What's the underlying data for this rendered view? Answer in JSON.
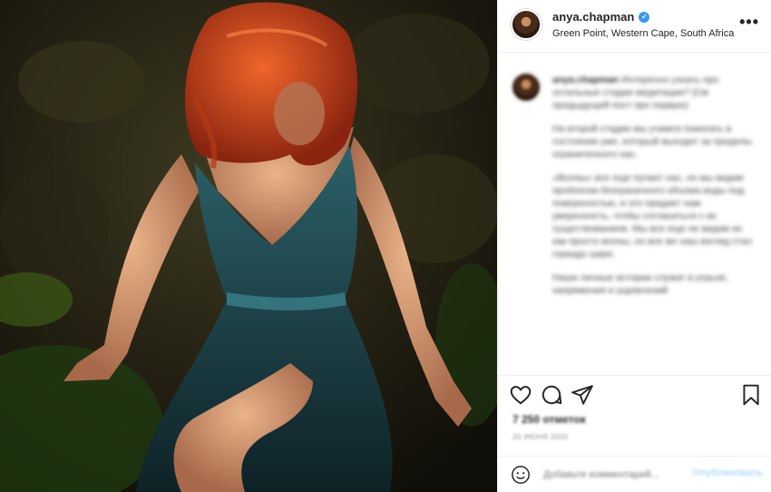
{
  "header": {
    "username": "anya.chapman",
    "location": "Green Point, Western Cape, South Africa",
    "more_label": "•••"
  },
  "caption": {
    "username": "anya.chapman",
    "paragraphs": [
      "Интересно узнать про остальные стадии медитации? (См предыдущий пост про первую)",
      "На второй стадии мы учимся помогать в состоянии уже, который выходит за пределы ограниченного нас.",
      "«Волны» все еще пугают нас, но мы видим проблески безграничного объема воды под поверхностью, и это придает нам уверенность, чтобы согласиться с их существованием. Мы все еще не видим их как просто волны, но все же наш взгляд стал гораздо шире.",
      "Наши личные истории служат в угрызе, напряжения и ущемлений"
    ]
  },
  "stats": {
    "likes": "7 250 отметок",
    "date": "20 ИЮНЯ 2020"
  },
  "comment": {
    "placeholder": "Добавьте комментарий...",
    "post_label": "Опубликовать"
  },
  "colors": {
    "verified": "#3897f0",
    "dress": "#1f4a4f",
    "hair": "#d2451c"
  },
  "icons": [
    "heart-icon",
    "comment-icon",
    "share-icon",
    "bookmark-icon",
    "emoji-icon",
    "verified-icon"
  ]
}
